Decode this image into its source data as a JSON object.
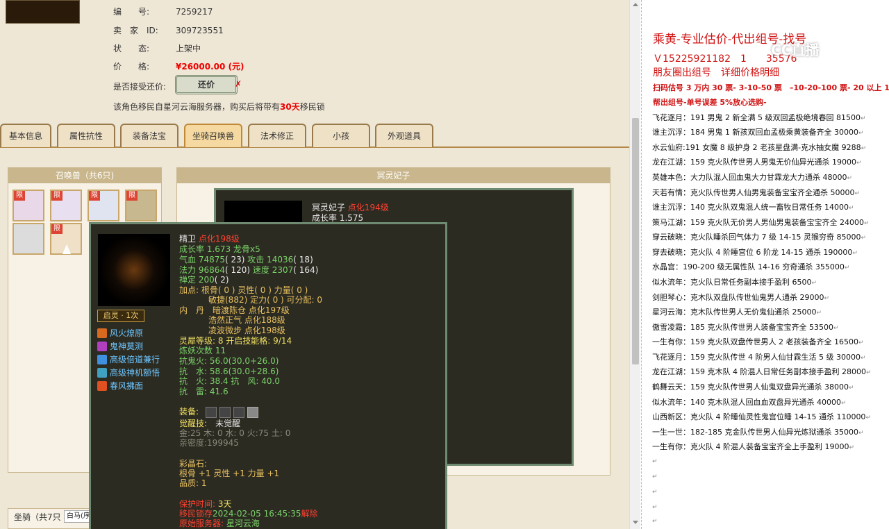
{
  "listing": {
    "id_label": "编　　号:",
    "id_value": "7259217",
    "seller_label": "卖　家　ID:",
    "seller_value": "309723551",
    "status_label": "状　　态:",
    "status_value": "上架中",
    "price_label": "价　　格:",
    "price_value": "¥26000.00 (元)",
    "offer_label": "是否接受还价:",
    "offer_button": "还价",
    "offer_x": "✗",
    "migrate_notice_a": "该角色移民自星河云海服务器，购买后将带有",
    "migrate_days": "30天",
    "migrate_notice_b": "移民锁"
  },
  "tabs": [
    {
      "label": "基本信息"
    },
    {
      "label": "属性抗性"
    },
    {
      "label": "装备法宝"
    },
    {
      "label": "坐骑召唤兽"
    },
    {
      "label": "法术修正"
    },
    {
      "label": "小孩"
    },
    {
      "label": "外观道具"
    }
  ],
  "pets_panel": {
    "title": "召唤兽（共6只)",
    "badge": "限"
  },
  "pet_detail": {
    "title": "冥灵妃子",
    "name": "冥灵妃子",
    "level": "点化194级",
    "growth": "成长率 1.575"
  },
  "tooltip": {
    "name": "精卫",
    "level": "点化198级",
    "line_growth": "成长率 1.673 龙骨x5",
    "hp_label": "气血 ",
    "hp_val": "74875",
    "hp_rest": "( 23) ",
    "atk_label": "攻击 ",
    "atk_val": "14036",
    "atk_rest": "( 18)",
    "mp_label": "法力 ",
    "mp_val": "96864",
    "mp_rest": "( 120) ",
    "spd_label": "速度 ",
    "spd_val": "2307",
    "spd_rest": "( 164)",
    "def_label": "禅定 ",
    "def_val": "200",
    "def_rest": "( 2)",
    "add_line1": "加点:  根骨( 0 ) 灵性( 0 ) 力量( 0 )",
    "add_line2": "敏捷(882) 定力( 0 ) 可分配:  0",
    "neidan_label": "内　丹",
    "neidan1": "暗渡陈仓 点化197级",
    "neidan2": "浩然正气 点化188级",
    "neidan3": "凌波微步 点化198级",
    "awaken_tag": "启灵 · 1次",
    "lingxi": "灵犀等级:  8 开启技能格:  9/14",
    "lianyao": "炼妖次数 11",
    "res1": "抗鬼火: 56.0(30.0+26.0)",
    "res2": "抗　水: 58.6(30.0+28.6)",
    "res3": "抗　火: 38.4 抗　风: 40.0",
    "res4": "抗　雷: 41.6",
    "equip_label": "装备:",
    "juexing_label": "觉醒技:",
    "juexing_val": "未觉醒",
    "elements": "金:25 木: 0 水: 0 火:75 土: 0",
    "intimacy": "亲密度:199945",
    "crystal_label": "彩晶石:",
    "crystal_line": "根骨 +1 灵性 +1 力量 +1",
    "quality": "品质:  1",
    "protect_label": "保护时间: ",
    "protect_val": "3天",
    "migrate_label": "移民锁存",
    "migrate_val": "2024-02-05 16:45:35",
    "migrate_tail": "解除",
    "origin_label": "原始服务器: ",
    "origin_val": "星河云海"
  },
  "skills": [
    "风火燎原",
    "鬼神莫测",
    "高级倍道兼行",
    "高级神机额悟",
    "春风拂面"
  ],
  "bottom": {
    "mount_label": "坐骑（共7只",
    "mount_tab": "白马(序"
  },
  "right": {
    "title": "乘黄-专业估价-代出组号-找号",
    "contact": "Ｖ15225921182　1",
    "contact_tail": "35576",
    "moments": "朋友圈出组号　详细价格明细",
    "promo1": "扫码估号 3 万内 30 票- 3-10-50 票　–10-20-100 票- 20 以上 150",
    "promo2": "帮出组号-单号误差 5%放心选购-",
    "watermark": "CC直播",
    "para_mark": "↵",
    "lines": [
      "飞花逐月：191 男鬼 2 新全满 5 级双回孟极绝境春回 81500",
      "谁主沉浮：184 男鬼 1 新孩双回血孟极乘黄装备齐全 30000",
      "水云仙府:191 女魔 8 级护身 2 老孩星盘满-克水抽女魔  9288",
      "龙在江湖：159 克火队传世男人男鬼无价仙异光通杀 19000",
      "英雄本色：大力队混人回血鬼大力甘霖龙大力通杀 48000",
      "天若有情：克火队传世男人仙男鬼装备宝宝齐全通杀 50000",
      "谁主沉浮：140 克火队双鬼混人统一畜牧日常任务 14000",
      "策马江湖：159 克火队无价男人男仙男鬼装备宝宝齐全 24000",
      "穿云破晓：克火队睡杀回气体力 7 级 14-15 灵猴穷奇 85000",
      "穿去破晓：克火队 4 阶睡宫位 6 阶龙 14-15 通杀 190000",
      "水晶宫：190-200 级无属性队 14-16 穷奇通杀 355000",
      "似水流年：克火队日常任务副本接手盈利 6500",
      "剑胆琴心：克木队双盘队传世仙鬼男人通杀 29000",
      "星河云海：克木队传世男人无价鬼仙通杀 25000",
      "傲雪凌霜：185 克火队传世男人装备宝宝齐全 53500",
      "一生有你：159 克火队双盘传世男人 2 老孩装备齐全 16500",
      "飞花逐月：159 克火队传世 4 阶男人仙甘霖生活 5 级 30000",
      "龙在江湖：159 克木队 4 阶混人日常任务副本接手盈利 28000",
      "鹤舞云天：159 克火队传世男人仙鬼双盘异光通杀 38000",
      "似水流年：140 克木队混人回血血双盘异光通杀 40000",
      "山西新区：克火队 4 阶睡仙灵性鬼宫位睡 14-15 通杀 110000",
      "一生一世：182-185 克金队传世男人仙异光炼狱通杀 35000",
      "一生有你：克火队 4 阶混人装备宝宝齐全上手盈利 19000"
    ]
  },
  "colors": {
    "accent_red": "#d01010",
    "tab_active": "#f5d9a0",
    "tooltip_bg": "#2c2b22"
  }
}
